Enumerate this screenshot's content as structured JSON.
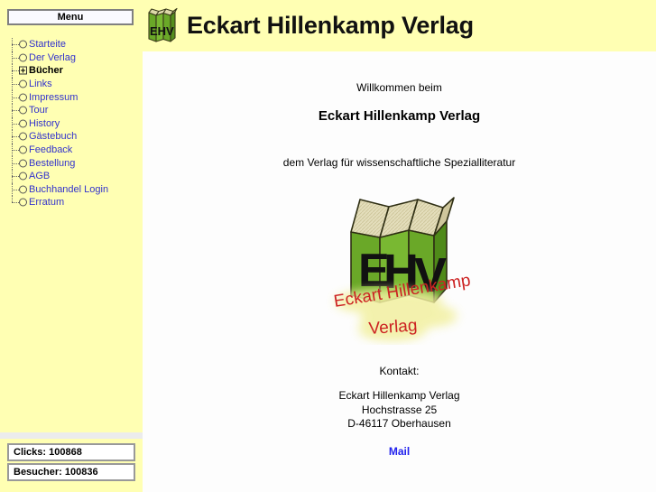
{
  "header": {
    "title": "Eckart Hillenkamp Verlag",
    "logo_icon": "ehv-books-icon",
    "background_color": "#ffffb3"
  },
  "sidebar": {
    "menu_title": "Menu",
    "background_color": "#ffffb3",
    "link_color": "#3333cc",
    "items": [
      {
        "label": "Starteite",
        "icon": "circle-node-icon",
        "bold": false
      },
      {
        "label": "Der Verlag",
        "icon": "circle-node-icon",
        "bold": false
      },
      {
        "label": "Bücher",
        "icon": "plus-box-icon",
        "bold": true
      },
      {
        "label": "Links",
        "icon": "circle-node-icon",
        "bold": false
      },
      {
        "label": "Impressum",
        "icon": "circle-node-icon",
        "bold": false
      },
      {
        "label": "Tour",
        "icon": "circle-node-icon",
        "bold": false
      },
      {
        "label": "History",
        "icon": "circle-node-icon",
        "bold": false
      },
      {
        "label": "Gästebuch",
        "icon": "circle-node-icon",
        "bold": false
      },
      {
        "label": "Feedback",
        "icon": "circle-node-icon",
        "bold": false
      },
      {
        "label": "Bestellung",
        "icon": "circle-node-icon",
        "bold": false
      },
      {
        "label": "AGB",
        "icon": "circle-node-icon",
        "bold": false
      },
      {
        "label": "Buchhandel Login",
        "icon": "circle-node-icon",
        "bold": false
      },
      {
        "label": "Erratum",
        "icon": "circle-node-icon",
        "bold": false
      }
    ]
  },
  "counters": {
    "clicks": "Clicks: 100868",
    "visitors": "Besucher: 100836"
  },
  "main": {
    "welcome_small": "Willkommen beim",
    "welcome_big": "Eckart Hillenkamp Verlag",
    "subtitle": "dem Verlag für wissenschaftliche Spezialliteratur",
    "logo": {
      "icon": "ehv-books-logo",
      "letters": "EHV",
      "caption_line1": "Eckart Hillenkamp",
      "caption_line2": "Verlag",
      "caption_color": "#cc2222",
      "book_color": "#66aa22",
      "book_color_dark": "#558811",
      "page_color": "#e8e0a8"
    },
    "contact": {
      "heading": "Kontakt:",
      "line1": "Eckart Hillenkamp Verlag",
      "line2": "Hochstrasse 25",
      "line3": "D-46117 Oberhausen",
      "mail_label": "Mail",
      "mail_color": "#2222ee"
    }
  }
}
